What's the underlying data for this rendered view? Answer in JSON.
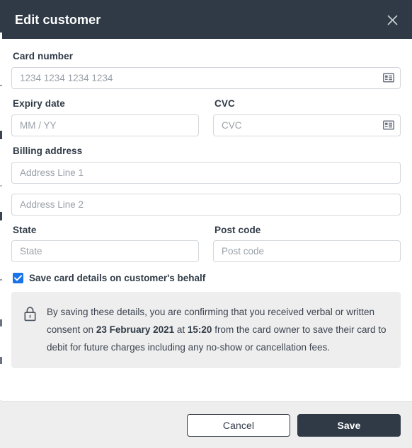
{
  "modal": {
    "title": "Edit customer",
    "close_icon": "close-icon"
  },
  "theme": {
    "header_bg": "#2f3a46",
    "accent_checkbox": "#1a73e8",
    "notice_bg": "#eeeeee",
    "footer_bg": "#eeeeee",
    "border": "#d3d7db",
    "placeholder": "#9aa1a8"
  },
  "form": {
    "card_number": {
      "label": "Card number",
      "placeholder": "1234 1234 1234 1234",
      "value": "",
      "icon": "credit-card-icon"
    },
    "expiry_date": {
      "label": "Expiry date",
      "placeholder": "MM / YY",
      "value": ""
    },
    "cvc": {
      "label": "CVC",
      "placeholder": "CVC",
      "value": "",
      "icon": "credit-card-icon"
    },
    "billing_address": {
      "label": "Billing address",
      "line1_placeholder": "Address Line 1",
      "line1_value": "",
      "line2_placeholder": "Address Line 2",
      "line2_value": ""
    },
    "state": {
      "label": "State",
      "placeholder": "State",
      "value": ""
    },
    "post_code": {
      "label": "Post code",
      "placeholder": "Post code",
      "value": ""
    },
    "save_card_checkbox": {
      "label": "Save card details on customer's behalf",
      "checked": true
    }
  },
  "notice": {
    "icon": "lock-icon",
    "text_part_1": "By saving these details, you are confirming that you received verbal or written consent on ",
    "bold_date": "23 February 2021",
    "text_part_2": " at ",
    "bold_time": "15:20",
    "text_part_3": " from the card owner to save their card to debit for future charges including any no-show or cancellation fees."
  },
  "footer": {
    "cancel_label": "Cancel",
    "save_label": "Save"
  }
}
